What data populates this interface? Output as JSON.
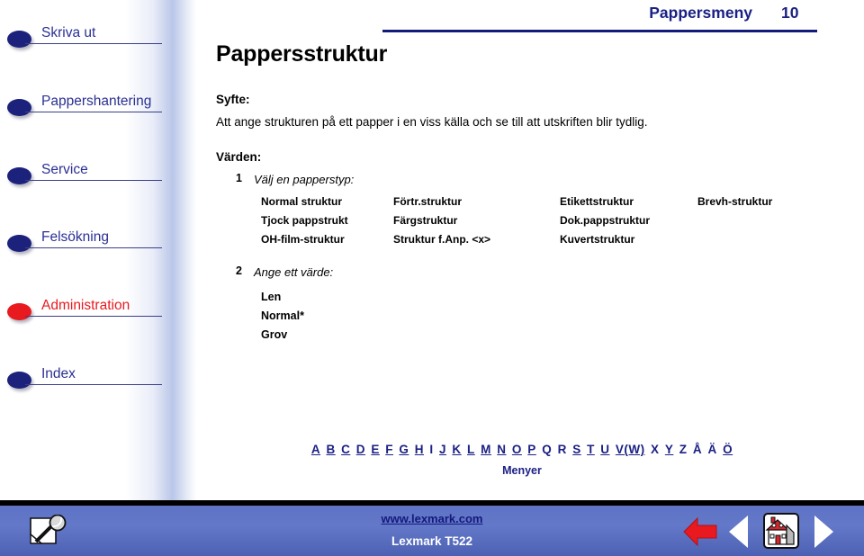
{
  "header": {
    "title": "Pappersmeny",
    "page_number": "10",
    "rule_color": "#141a7a"
  },
  "sidebar": {
    "items": [
      {
        "label": "Skriva ut",
        "bullet_color": "#1c227c",
        "text_color": "#2a3093",
        "active": false
      },
      {
        "label": "Pappershantering",
        "bullet_color": "#1c227c",
        "text_color": "#2a3093",
        "active": false
      },
      {
        "label": "Service",
        "bullet_color": "#1c227c",
        "text_color": "#2a3093",
        "active": false
      },
      {
        "label": "Felsökning",
        "bullet_color": "#1c227c",
        "text_color": "#2a3093",
        "active": false
      },
      {
        "label": "Administration",
        "bullet_color": "#e8191f",
        "text_color": "#e8191f",
        "active": true
      },
      {
        "label": "Index",
        "bullet_color": "#1c227c",
        "text_color": "#2a3093",
        "active": false
      }
    ]
  },
  "main": {
    "doc_title": "Pappersstruktur",
    "purpose_heading": "Syfte:",
    "purpose_text": "Att ange strukturen på ett papper i en viss källa och se till att utskriften blir tydlig.",
    "values_heading": "Värden:",
    "step1": {
      "num": "1",
      "text": "Välj en papperstyp:"
    },
    "paper_types": [
      [
        "Normal struktur",
        "Förtr.struktur",
        "Etikettstruktur",
        "Brevh-struktur"
      ],
      [
        "Tjock pappstrukt",
        "Färgstruktur",
        "Dok.pappstruktur",
        ""
      ],
      [
        "OH-film-struktur",
        "Struktur f.Anp. <x>",
        "Kuvertstruktur",
        ""
      ]
    ],
    "step2": {
      "num": "2",
      "text": "Ange ett värde:"
    },
    "texture_values": [
      "Len",
      "Normal*",
      "Grov"
    ]
  },
  "alpha_index": {
    "letters": [
      "A",
      "B",
      "C",
      "D",
      "E",
      "F",
      "G",
      "H",
      "I",
      "J",
      "K",
      "L",
      "M",
      "N",
      "O",
      "P",
      "Q",
      "R",
      "S",
      "T",
      "U",
      "V(W)",
      "X",
      "Y",
      "Z",
      "Å",
      "Ä",
      "Ö"
    ],
    "menu_label": "Menyer",
    "link_color": "#1b2184"
  },
  "footer": {
    "url": "www.lexmark.com",
    "model": "Lexmark T522",
    "icons": [
      "search-icon",
      "back-arrow-icon",
      "previous-page-icon",
      "home-icon",
      "next-page-icon"
    ],
    "bar_color": "#6478c9",
    "back_arrow_color": "#e8191f"
  }
}
